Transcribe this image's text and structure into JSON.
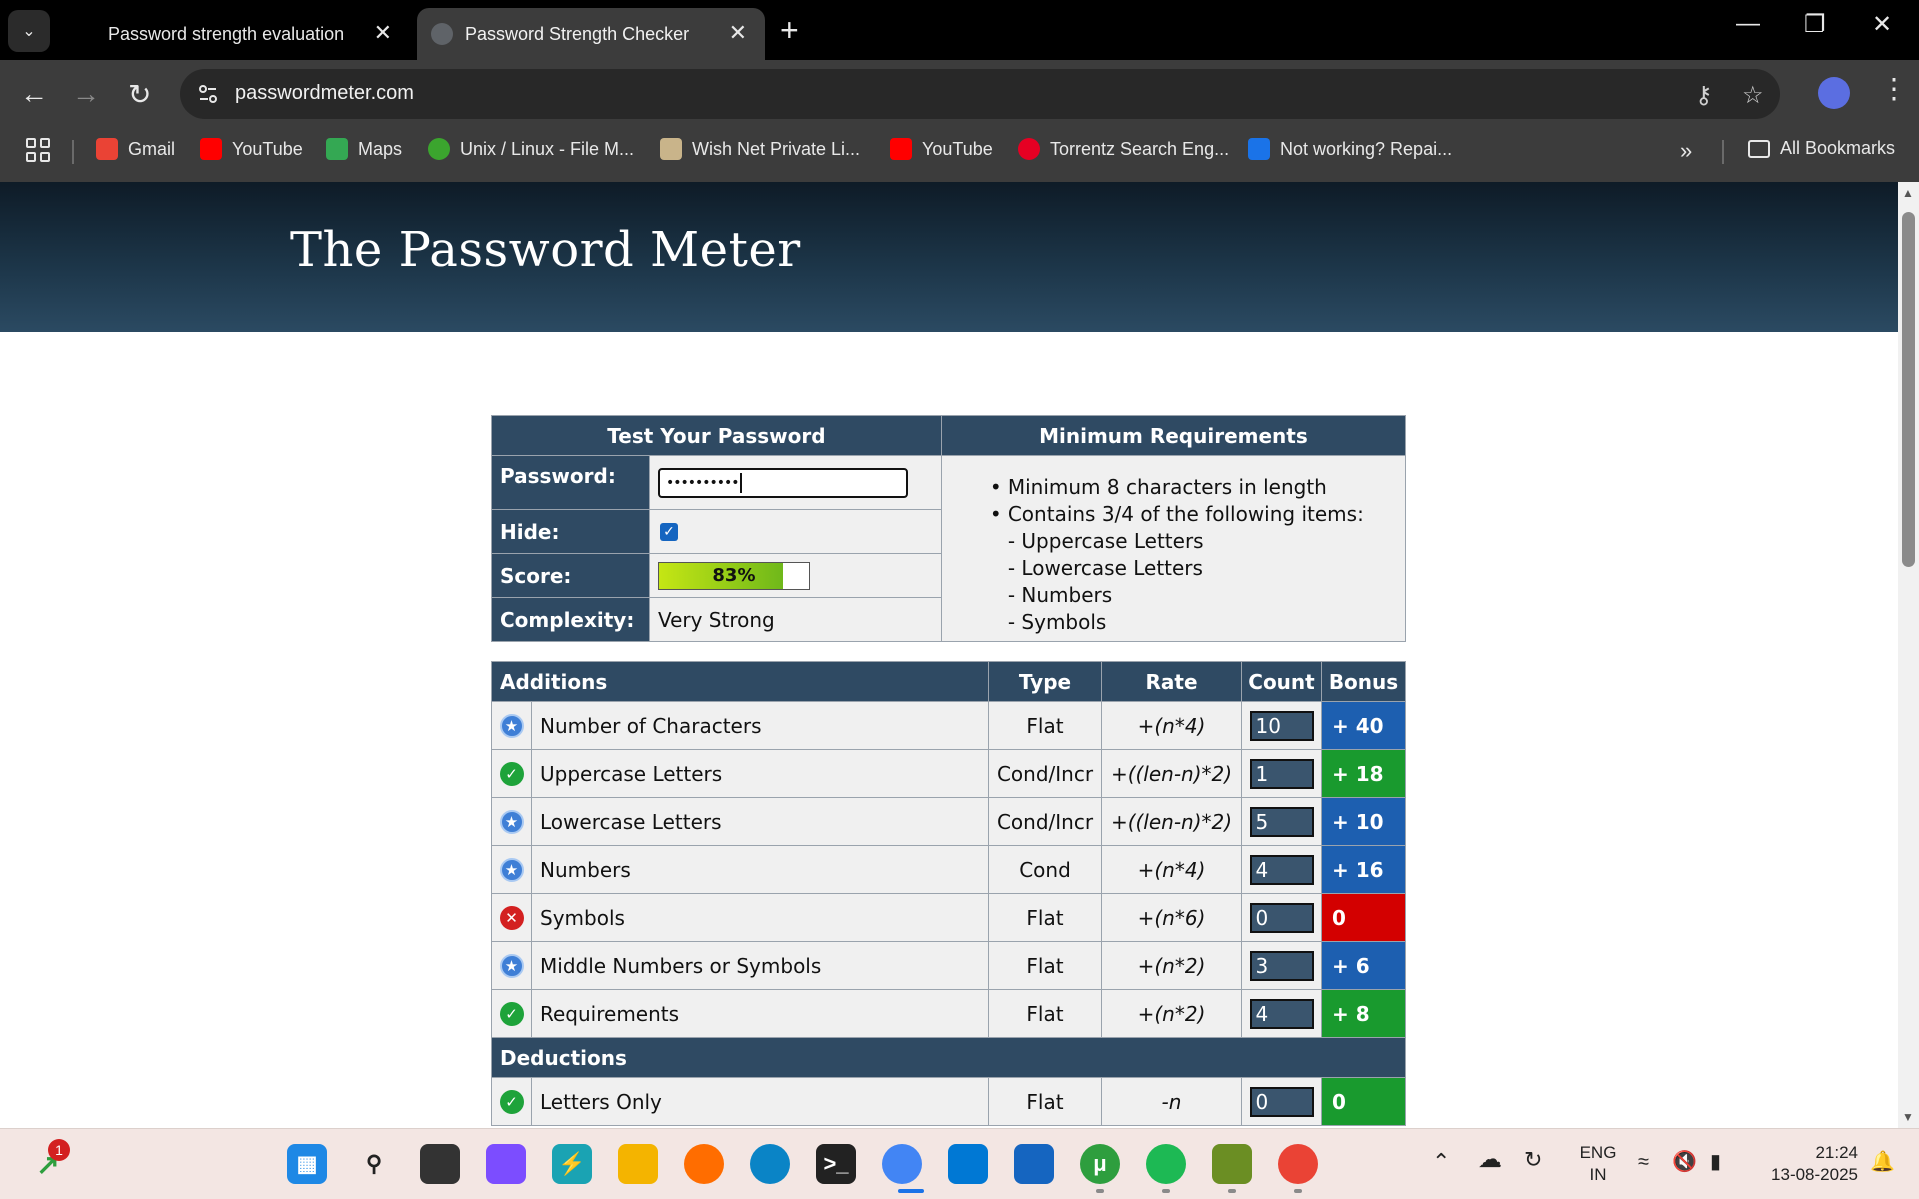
{
  "browser": {
    "tabs": [
      {
        "title": "Password strength evaluation",
        "active": false
      },
      {
        "title": "Password Strength Checker",
        "active": true
      }
    ],
    "url": "passwordmeter.com",
    "bookmarks": [
      {
        "label": "Gmail",
        "icon": "gmail-icon",
        "color": "#ea4335"
      },
      {
        "label": "YouTube",
        "icon": "youtube-icon",
        "color": "#ff0000"
      },
      {
        "label": "Maps",
        "icon": "maps-icon",
        "color": "#34a853"
      },
      {
        "label": "Unix / Linux - File M...",
        "icon": "unix-icon",
        "color": "#3ba52e"
      },
      {
        "label": "Wish Net Private Li...",
        "icon": "wishnet-icon",
        "color": "#c9b48a"
      },
      {
        "label": "YouTube",
        "icon": "youtube-icon",
        "color": "#ff0000"
      },
      {
        "label": "Torrentz Search Eng...",
        "icon": "pinterest-icon",
        "color": "#e60023"
      },
      {
        "label": "Not working? Repai...",
        "icon": "repair-icon",
        "color": "#1a73e8"
      }
    ],
    "all_bookmarks_label": "All Bookmarks"
  },
  "page": {
    "title": "The Password Meter",
    "test_header": "Test Your Password",
    "requirements_header": "Minimum Requirements",
    "password_label": "Password:",
    "password_masked": "••••••••••",
    "hide_label": "Hide:",
    "hide_checked": true,
    "score_label": "Score:",
    "score_text": "83%",
    "score_value": 0.83,
    "complexity_label": "Complexity:",
    "complexity_value": "Very Strong",
    "requirements": [
      "Minimum 8 characters in length",
      "Contains 3/4 of the following items:",
      "- Uppercase Letters",
      "- Lowercase Letters",
      "- Numbers",
      "- Symbols"
    ],
    "additions_header": {
      "name": "Additions",
      "type": "Type",
      "rate": "Rate",
      "count": "Count",
      "bonus": "Bonus"
    },
    "additions": [
      {
        "status": "exceed",
        "name": "Number of Characters",
        "type": "Flat",
        "rate": "+(n*4)",
        "count": "10",
        "bonus": "+ 40",
        "bonus_color": "blue"
      },
      {
        "status": "ok",
        "name": "Uppercase Letters",
        "type": "Cond/Incr",
        "rate": "+((len-n)*2)",
        "count": "1",
        "bonus": "+ 18",
        "bonus_color": "green"
      },
      {
        "status": "exceed",
        "name": "Lowercase Letters",
        "type": "Cond/Incr",
        "rate": "+((len-n)*2)",
        "count": "5",
        "bonus": "+ 10",
        "bonus_color": "blue"
      },
      {
        "status": "exceed",
        "name": "Numbers",
        "type": "Cond",
        "rate": "+(n*4)",
        "count": "4",
        "bonus": "+ 16",
        "bonus_color": "blue"
      },
      {
        "status": "fail",
        "name": "Symbols",
        "type": "Flat",
        "rate": "+(n*6)",
        "count": "0",
        "bonus": "0",
        "bonus_color": "red"
      },
      {
        "status": "exceed",
        "name": "Middle Numbers or Symbols",
        "type": "Flat",
        "rate": "+(n*2)",
        "count": "3",
        "bonus": "+ 6",
        "bonus_color": "blue"
      },
      {
        "status": "ok",
        "name": "Requirements",
        "type": "Flat",
        "rate": "+(n*2)",
        "count": "4",
        "bonus": "+ 8",
        "bonus_color": "green"
      }
    ],
    "deductions_header": "Deductions",
    "deductions": [
      {
        "status": "ok",
        "name": "Letters Only",
        "type": "Flat",
        "rate": "-n",
        "count": "0",
        "bonus": "0",
        "bonus_color": "green"
      }
    ]
  },
  "taskbar": {
    "notification_count": "1",
    "language_line1": "ENG",
    "language_line2": "IN",
    "time": "21:24",
    "date": "13-08-2025"
  }
}
